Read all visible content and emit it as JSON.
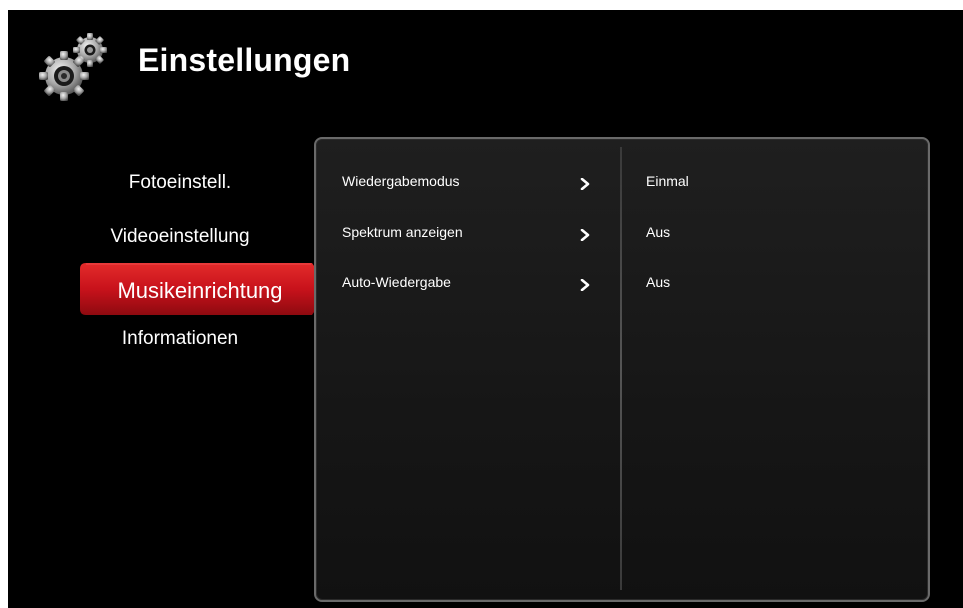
{
  "header": {
    "title": "Einstellungen",
    "icon": "gears-icon"
  },
  "sidebar": {
    "items": [
      {
        "label": "Fotoeinstell.",
        "selected": false
      },
      {
        "label": "Videoeinstellung",
        "selected": false
      },
      {
        "label": "Musikeinrichtung",
        "selected": true
      },
      {
        "label": "Informationen",
        "selected": false
      }
    ]
  },
  "options": [
    {
      "label": "Wiedergabemodus",
      "value": "Einmal",
      "icon": "chevron-right-icon"
    },
    {
      "label": "Spektrum anzeigen",
      "value": "Aus",
      "icon": "chevron-right-icon"
    },
    {
      "label": "Auto-Wiedergabe",
      "value": "Aus",
      "icon": "chevron-right-icon"
    }
  ],
  "colors": {
    "background": "#000000",
    "selection_red": "#c8121b",
    "panel_border": "#6a6a6a",
    "text": "#ffffff"
  }
}
